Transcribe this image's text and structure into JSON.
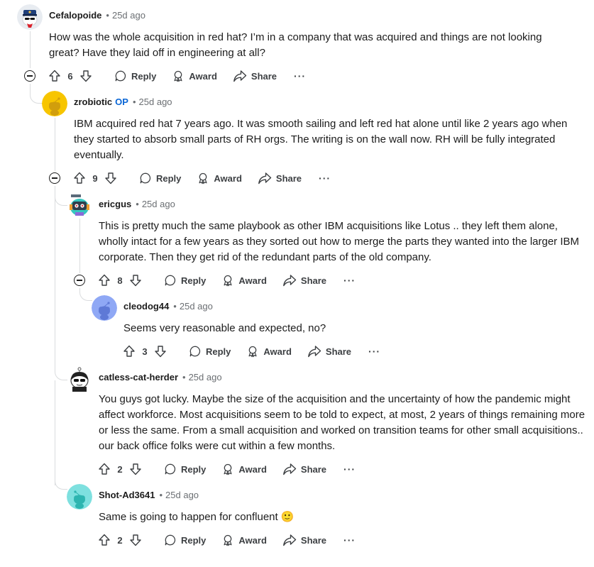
{
  "actions": {
    "reply": "Reply",
    "award": "Award",
    "share": "Share",
    "more": "···"
  },
  "comments": [
    {
      "username": "Cefalopoide",
      "time": "25d ago",
      "body": "How was the whole acquisition in red hat? I’m in a company that was acquired and things are not looking great? Have they laid off in engineering at all?",
      "score": "6",
      "avatar_icon": "police-snoo-avatar-icon"
    },
    {
      "username": "zrobiotic",
      "op_badge": "OP",
      "time": "25d ago",
      "body": "IBM acquired red hat 7 years ago. It was smooth sailing and left red hat alone until like 2 years ago when they started to absorb small parts of RH orgs. The writing is on the wall now. RH will be fully integrated eventually.",
      "score": "9",
      "avatar_icon": "yellow-snoo-avatar-icon"
    },
    {
      "username": "ericgus",
      "time": "25d ago",
      "body": "This is pretty much the same playbook as other IBM acquisitions like Lotus .. they left them alone, wholly intact for a few years as they sorted out how to merge the parts they wanted into the larger IBM corporate. Then they get rid of the redundant parts of the old company.",
      "score": "8",
      "avatar_icon": "robot-snoo-avatar-icon"
    },
    {
      "username": "cleodog44",
      "time": "25d ago",
      "body": "Seems very reasonable and expected, no?",
      "score": "3",
      "avatar_icon": "blue-snoo-avatar-icon"
    },
    {
      "username": "catless-cat-herder",
      "time": "25d ago",
      "body": "You guys got lucky. Maybe the size of the acquisition and the uncertainty of how the pandemic might affect workforce. Most acquisitions seem to be told to expect, at most, 2 years of things remaining more or less the same. From a small acquisition and worked on transition teams for other small acquisitions.. our back office folks were cut within a few months.",
      "score": "2",
      "avatar_icon": "sunglasses-snoo-avatar-icon"
    },
    {
      "username": "Shot-Ad3641",
      "time": "25d ago",
      "body": "Same is going to happen for confluent 🙂",
      "score": "2",
      "avatar_icon": "teal-snoo-avatar-icon"
    }
  ]
}
